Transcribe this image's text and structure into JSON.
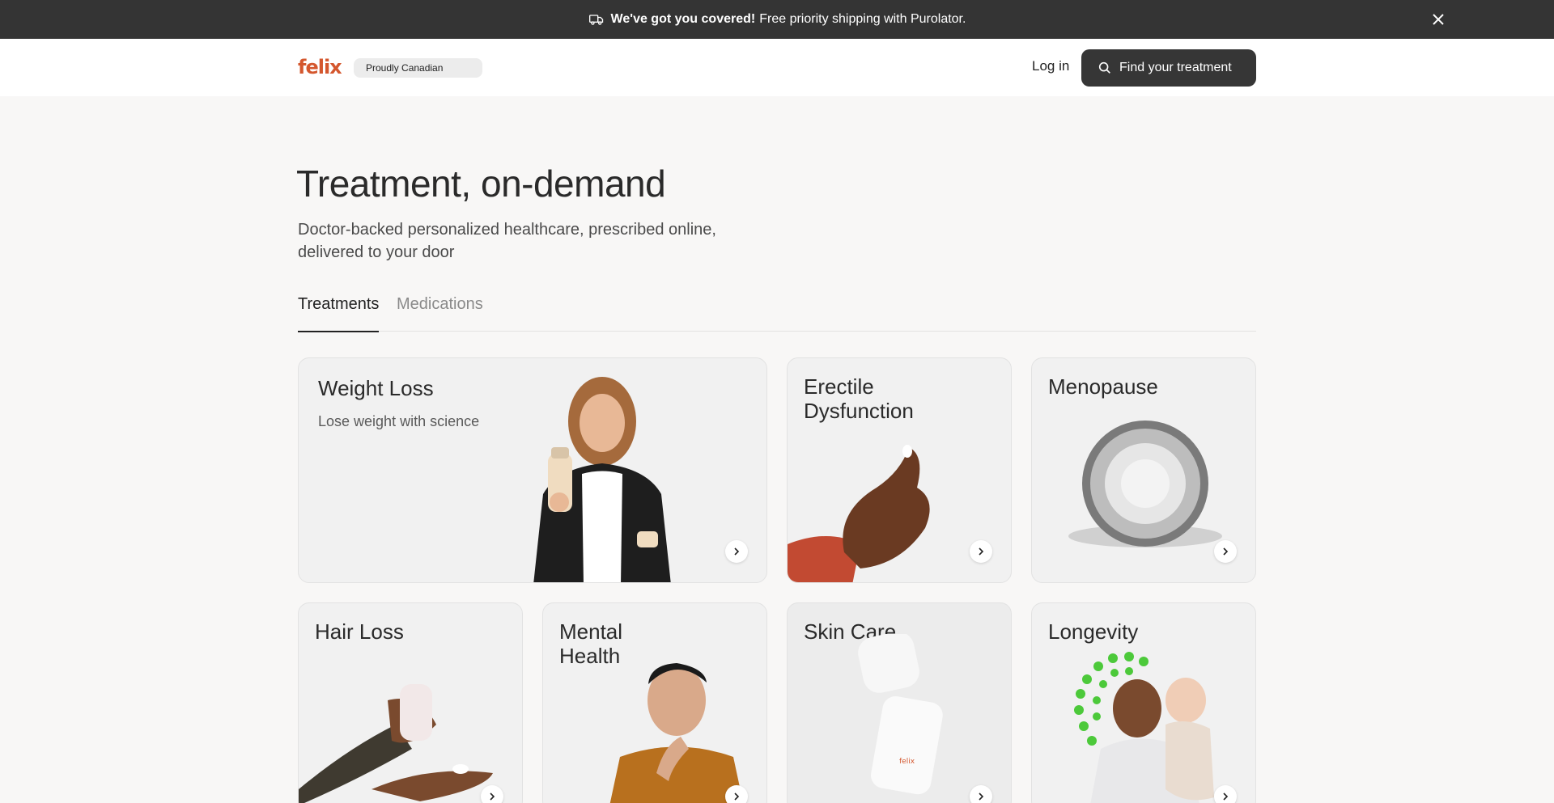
{
  "announcement": {
    "bold": "We've got you covered!",
    "text": "Free priority shipping with Purolator.",
    "icon": "truck-icon"
  },
  "header": {
    "logo": "felix",
    "badge": "Proudly Canadian",
    "login": "Log in",
    "cta": "Find your treatment"
  },
  "hero": {
    "title": "Treatment, on-demand",
    "subtitle": "Doctor-backed personalized healthcare, prescribed online, delivered to your door"
  },
  "tabs": [
    {
      "label": "Treatments",
      "active": true
    },
    {
      "label": "Medications",
      "active": false
    }
  ],
  "cards": [
    {
      "title": "Weight Loss",
      "subtitle": "Lose weight with science"
    },
    {
      "title": "Erectile Dysfunction"
    },
    {
      "title": "Menopause"
    },
    {
      "title": "Hair Loss"
    },
    {
      "title": "Mental Health"
    },
    {
      "title": "Skin Care"
    },
    {
      "title": "Longevity"
    }
  ],
  "colors": {
    "brand": "#d4572e",
    "announce_bg": "#343434",
    "cta_bg": "#363636",
    "accent_green": "#4cc93a"
  }
}
